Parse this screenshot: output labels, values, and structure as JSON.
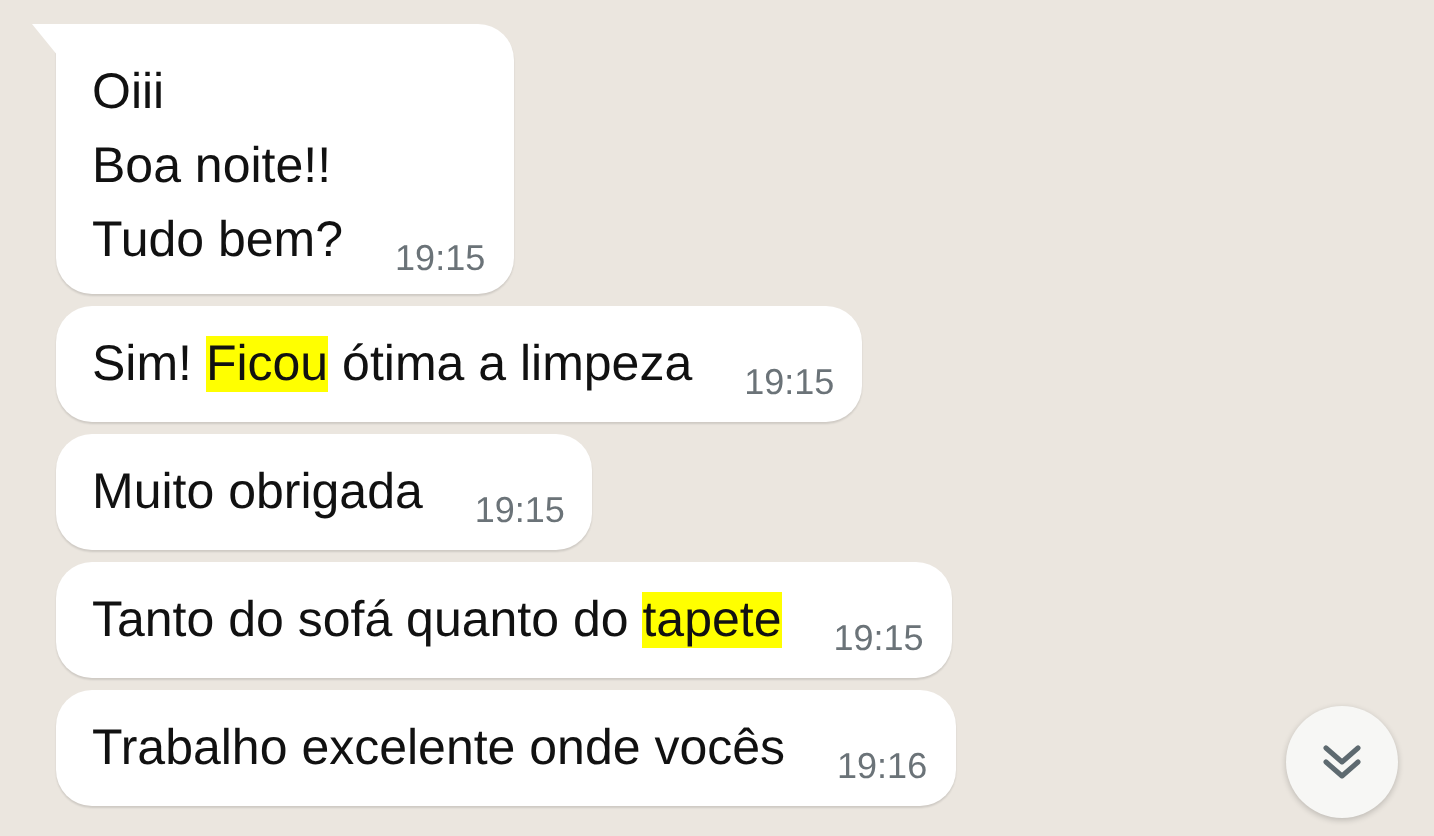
{
  "messages": [
    {
      "tail": true,
      "time": "19:15",
      "lines": [
        [
          {
            "text": "Oiii",
            "highlighted": false
          }
        ],
        [
          {
            "text": "Boa noite!!",
            "highlighted": false
          }
        ],
        [
          {
            "text": "Tudo bem?",
            "highlighted": false
          }
        ]
      ]
    },
    {
      "tail": false,
      "time": "19:15",
      "lines": [
        [
          {
            "text": "Sim! ",
            "highlighted": false
          },
          {
            "text": "Ficou",
            "highlighted": true
          },
          {
            "text": " ótima a limpeza",
            "highlighted": false
          }
        ]
      ]
    },
    {
      "tail": false,
      "time": "19:15",
      "lines": [
        [
          {
            "text": "Muito obrigada",
            "highlighted": false
          }
        ]
      ]
    },
    {
      "tail": false,
      "time": "19:15",
      "lines": [
        [
          {
            "text": "Tanto do sofá quanto do ",
            "highlighted": false
          },
          {
            "text": "tapete",
            "highlighted": true
          }
        ]
      ]
    },
    {
      "tail": false,
      "time": "19:16",
      "lines": [
        [
          {
            "text": "Trabalho excelente onde vocês",
            "highlighted": false
          }
        ]
      ]
    }
  ]
}
